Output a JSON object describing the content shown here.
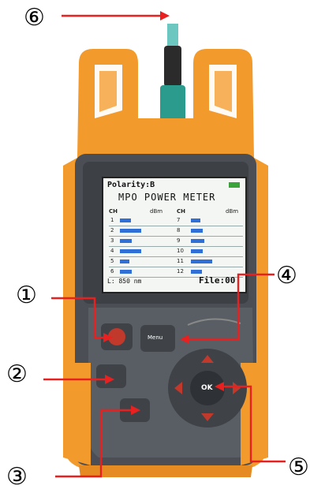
{
  "callouts": {
    "c1": "①",
    "c2": "②",
    "c3": "③",
    "c4": "④",
    "c5": "⑤",
    "c6": "⑥"
  },
  "screen": {
    "polarity": "Polarity:B",
    "title": "MPO POWER METER",
    "col_ch": "CH",
    "col_dbm": "dBm",
    "footer_wavelength": "L: 850 nm",
    "footer_file": "File:00",
    "left_channels": [
      "1",
      "2",
      "3",
      "4",
      "5",
      "6"
    ],
    "right_channels": [
      "7",
      "8",
      "9",
      "10",
      "11",
      "12"
    ],
    "left_bar_fraction": [
      0.45,
      0.9,
      0.5,
      0.9,
      0.4,
      0.5
    ],
    "right_bar_fraction": [
      0.4,
      0.5,
      0.55,
      0.5,
      0.9,
      0.45
    ]
  },
  "device": {
    "ok_label": "OK",
    "menu_label": "Menu"
  },
  "colors": {
    "body": "#f39a2d",
    "panel": "#595e64",
    "arrow": "#e8201f",
    "bar": "#2f6fd6"
  }
}
